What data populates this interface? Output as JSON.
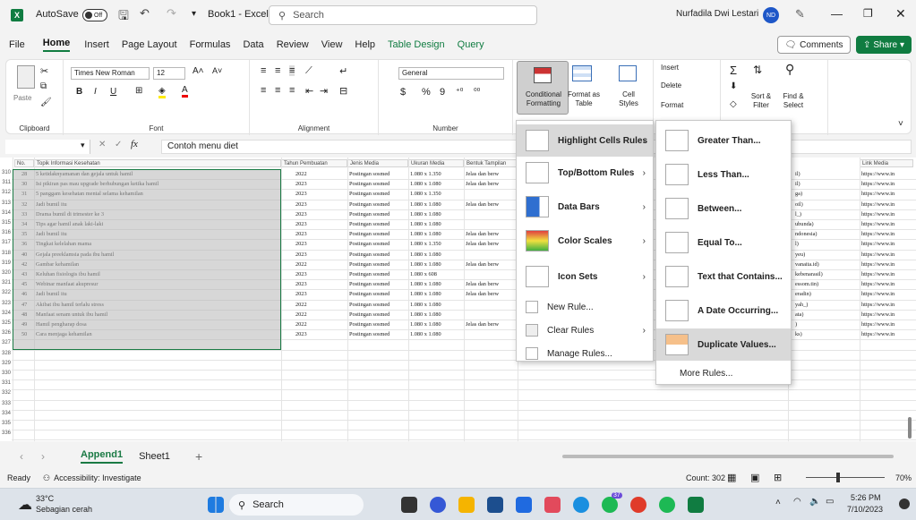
{
  "titlebar": {
    "autosave_label": "AutoSave",
    "autosave_state": "Off",
    "book_title": "Book1 - Excel",
    "search_placeholder": "Search",
    "user_name": "Nurfadila Dwi Lestari",
    "user_initials": "ND"
  },
  "menubar": {
    "items": [
      "File",
      "Home",
      "Insert",
      "Page Layout",
      "Formulas",
      "Data",
      "Review",
      "View",
      "Help",
      "Table Design",
      "Query"
    ],
    "comments": "Comments",
    "share": "Share"
  },
  "ribbon": {
    "clipboard": {
      "paste": "Paste",
      "label": "Clipboard"
    },
    "font": {
      "name": "Times New Roman",
      "size": "12",
      "label": "Font"
    },
    "alignment": {
      "label": "Alignment"
    },
    "number": {
      "format": "General",
      "label": "Number"
    },
    "styles": {
      "conditional": "Conditional Formatting",
      "format_as": "Format as Table",
      "cell": "Cell Styles"
    },
    "cells": {
      "insert": "Insert",
      "delete": "Delete",
      "format": "Format"
    },
    "editing": {
      "sort": "Sort & Filter",
      "find": "Find & Select"
    }
  },
  "formula_bar": {
    "fx": "fx",
    "content": "Contoh menu diet"
  },
  "headers": [
    "No.",
    "Topik Informasi Kesehatan",
    "Tahun Pembuatan",
    "Jenis Media",
    "Ukuran Media",
    "Bentuk Tampilan",
    "Link Media"
  ],
  "rows": [
    {
      "r": "310",
      "no": "28",
      "topic": "5 ketidaknyamanan dan gejala untuk hamil",
      "year": "2022",
      "media": "Postingan sosmed",
      "size": "1.080 x 1.350",
      "form": "Jelas dan berw",
      "src": "il)",
      "link": "https://www.in"
    },
    {
      "r": "311",
      "no": "30",
      "topic": "Isi pikiran pas mau upgrade berhubungan ketika hamil",
      "year": "2023",
      "media": "Postingan sosmed",
      "size": "1.080 x 1.080",
      "form": "Jelas dan berw",
      "src": "il)",
      "link": "https://www.in"
    },
    {
      "r": "312",
      "no": "31",
      "topic": "5 panggam kesehatan mental selama kehamilan",
      "year": "2023",
      "media": "Postingan sosmed",
      "size": "1.080 x 1.350",
      "form": "",
      "src": "ga)",
      "link": "https://www.in"
    },
    {
      "r": "313",
      "no": "32",
      "topic": "Jadi bumil itu",
      "year": "2023",
      "media": "Postingan sosmed",
      "size": "1.080 x 1.080",
      "form": "Jelas dan berw",
      "src": "oil)",
      "link": "https://www.in"
    },
    {
      "r": "314",
      "no": "33",
      "topic": "Drama bumil di trimester ke 3",
      "year": "2023",
      "media": "Postingan sosmed",
      "size": "1.080 x 1.080",
      "form": "",
      "src": "l_)",
      "link": "https://www.in"
    },
    {
      "r": "315",
      "no": "34",
      "topic": "Tips agar hamil anak laki-laki",
      "year": "2023",
      "media": "Postingan sosmed",
      "size": "1.080 x 1.080",
      "form": "",
      "src": "ubunda)",
      "link": "https://www.in"
    },
    {
      "r": "316",
      "no": "35",
      "topic": "Jadi bumil itu",
      "year": "2023",
      "media": "Postingan sosmed",
      "size": "1.080 x 1.080",
      "form": "Jelas dan berw",
      "src": "ndonesia)",
      "link": "https://www.in"
    },
    {
      "r": "317",
      "no": "36",
      "topic": "Tingkat kelelahan mama",
      "year": "2023",
      "media": "Postingan sosmed",
      "size": "1.080 x 1.350",
      "form": "Jelas dan berw",
      "src": "l)",
      "link": "https://www.in"
    },
    {
      "r": "318",
      "no": "40",
      "topic": "Gejala preeklamsia pada ibu hamil",
      "year": "2023",
      "media": "Postingan sosmed",
      "size": "1.080 x 1.080",
      "form": "",
      "src": "yeu)",
      "link": "https://www.in"
    },
    {
      "r": "319",
      "no": "42",
      "topic": "Gambar kehamilan",
      "year": "2022",
      "media": "Postingan sosmed",
      "size": "1.080 x 1.080",
      "form": "Jelas dan berw",
      "src": "vanaita.id)",
      "link": "https://www.in"
    },
    {
      "r": "320",
      "no": "43",
      "topic": "Keluhan fisiologis ibu hamil",
      "year": "2023",
      "media": "Postingan sosmed",
      "size": "1.080 x 608",
      "form": "",
      "src": "kebenarasil)",
      "link": "https://www.in"
    },
    {
      "r": "321",
      "no": "45",
      "topic": "Webinar manfaat akupresur",
      "year": "2023",
      "media": "Postingan sosmed",
      "size": "1.080 x 1.080",
      "form": "Jelas dan berw",
      "src": "essom.tin)",
      "link": "https://www.in"
    },
    {
      "r": "322",
      "no": "46",
      "topic": "Jadi bumil itu",
      "year": "2023",
      "media": "Postingan sosmed",
      "size": "1.080 x 1.080",
      "form": "Jelas dan berw",
      "src": "eradin)",
      "link": "https://www.in"
    },
    {
      "r": "323",
      "no": "47",
      "topic": "Akibat ibu hamil terlalu stress",
      "year": "2022",
      "media": "Postingan sosmed",
      "size": "1.080 x 1.080",
      "form": "",
      "src": "yah_)",
      "link": "https://www.in"
    },
    {
      "r": "324",
      "no": "48",
      "topic": "Manfaat senam untuk ibu hamil",
      "year": "2022",
      "media": "Postingan sosmed",
      "size": "1.080 x 1.080",
      "form": "",
      "src": "ata)",
      "link": "https://www.in"
    },
    {
      "r": "325",
      "no": "49",
      "topic": "Hamil pengharap dosa",
      "year": "2022",
      "media": "Postingan sosmed",
      "size": "1.080 x 1.080",
      "form": "Jelas dan berw",
      "src": ")",
      "link": "https://www.in"
    },
    {
      "r": "326",
      "no": "50",
      "topic": "Cara menjaga kehamilan",
      "year": "2023",
      "media": "Postingan sosmed",
      "size": "1.080 x 1.080",
      "form": "",
      "src": "ks)",
      "link": "https://www.in"
    }
  ],
  "empty_rows": [
    "327",
    "328",
    "329",
    "330",
    "331",
    "332",
    "333",
    "334",
    "335",
    "336"
  ],
  "cf_menu": [
    "Highlight Cells Rules",
    "Top/Bottom Rules",
    "Data Bars",
    "Color Scales",
    "Icon Sets",
    "New Rule...",
    "Clear Rules",
    "Manage Rules..."
  ],
  "hc_menu": [
    "Greater Than...",
    "Less Than...",
    "Between...",
    "Equal To...",
    "Text that Contains...",
    "A Date Occurring...",
    "Duplicate Values...",
    "More Rules..."
  ],
  "sheets": [
    "Append1",
    "Sheet1"
  ],
  "status": {
    "ready": "Ready",
    "accessibility": "Accessibility: Investigate",
    "count": "Count: 302",
    "zoom": "70%"
  },
  "taskbar": {
    "temp": "33°C",
    "weather": "Sebagian cerah",
    "search": "Search",
    "time": "5:26 PM",
    "date": "7/10/2023",
    "badge": "37"
  }
}
